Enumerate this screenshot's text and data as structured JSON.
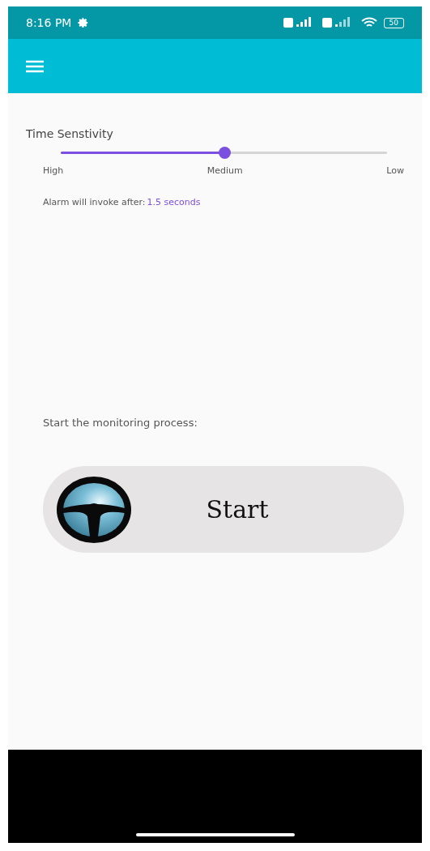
{
  "status_bar": {
    "time": "8:16 PM",
    "battery": "50"
  },
  "sensitivity": {
    "title": "Time Senstivity",
    "level": 0.5,
    "labels": [
      "High",
      "Medium",
      "Low"
    ]
  },
  "alarm": {
    "label": "Alarm will invoke after:",
    "value": "1.5 seconds"
  },
  "monitoring": {
    "prompt": "Start the monitoring process:",
    "button": "Start"
  }
}
